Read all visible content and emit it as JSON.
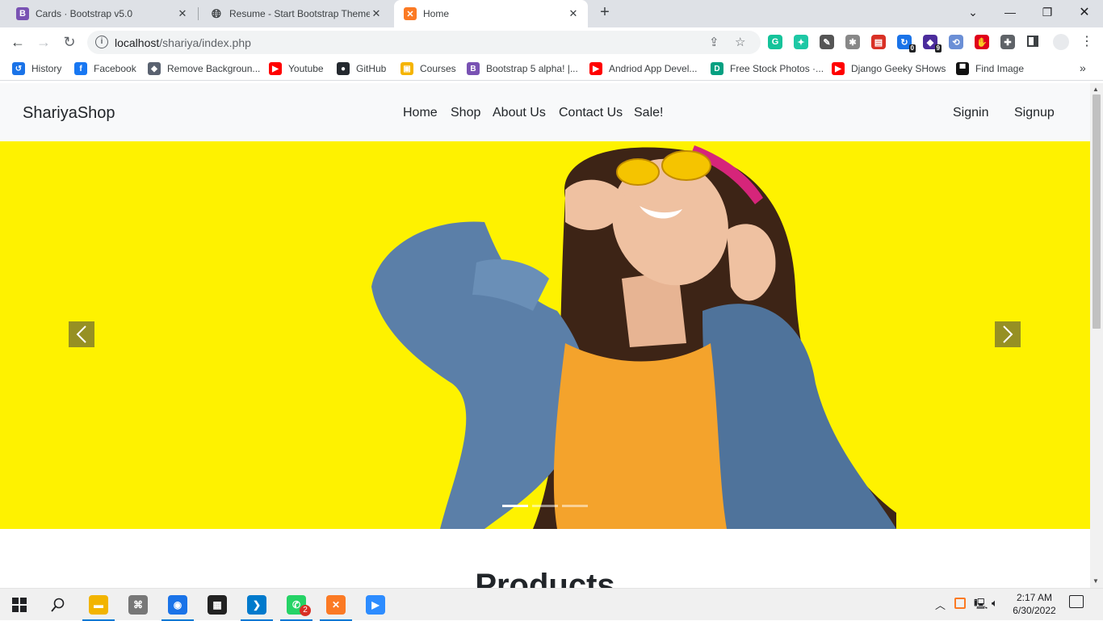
{
  "browser": {
    "tabs": [
      {
        "title": "Cards · Bootstrap v5.0",
        "icon": "bootstrap-icon",
        "color": "#7952b3"
      },
      {
        "title": "Resume - Start Bootstrap Theme",
        "icon": "globe-icon",
        "color": "#5f6368"
      },
      {
        "title": "Home",
        "icon": "xampp-icon",
        "color": "#fb7a24"
      }
    ],
    "new_tab": "+",
    "url_host": "localhost",
    "url_path": "/shariya/index.php",
    "bookmarks": [
      {
        "label": "History",
        "icon": "history-icon",
        "color": "#1a73e8"
      },
      {
        "label": "Facebook",
        "icon": "facebook-icon",
        "color": "#1877f2"
      },
      {
        "label": "Remove Backgroun...",
        "icon": "removebg-icon",
        "color": "#5a6270"
      },
      {
        "label": "Youtube",
        "icon": "youtube-icon",
        "color": "#ff0000"
      },
      {
        "label": "GitHub",
        "icon": "github-icon",
        "color": "#24292f"
      },
      {
        "label": "Courses",
        "icon": "classroom-icon",
        "color": "#f5b400"
      },
      {
        "label": "Bootstrap 5 alpha! |...",
        "icon": "bootstrap-icon",
        "color": "#7952b3"
      },
      {
        "label": "Andriod App Devel...",
        "icon": "youtube-icon",
        "color": "#ff0000"
      },
      {
        "label": "Free Stock Photos ·...",
        "icon": "stock-photo-icon",
        "color": "#05a081"
      },
      {
        "label": "Django Geeky SHows",
        "icon": "youtube-icon",
        "color": "#ff0000"
      },
      {
        "label": "Find Image",
        "icon": "unsplash-icon",
        "color": "#111111"
      }
    ],
    "extensions": [
      {
        "icon": "grammarly-icon",
        "color": "#15c39a",
        "badge": ""
      },
      {
        "icon": "tweeter-icon",
        "color": "#1ec8a5",
        "badge": ""
      },
      {
        "icon": "eyedropper-icon",
        "color": "#555555",
        "badge": ""
      },
      {
        "icon": "bug-icon",
        "color": "#888888",
        "badge": ""
      },
      {
        "icon": "web-page-icon",
        "color": "#d93025",
        "badge": ""
      },
      {
        "icon": "refresh-ext-icon",
        "color": "#1a73e8",
        "badge": "0"
      },
      {
        "icon": "gem-icon",
        "color": "#4b2c9c",
        "badge": "9"
      },
      {
        "icon": "loop-icon",
        "color": "#6b8fd6",
        "badge": ""
      },
      {
        "icon": "adblock-icon",
        "color": "#e0001b",
        "badge": ""
      },
      {
        "icon": "puzzle-icon",
        "color": "#5f6368",
        "badge": ""
      }
    ]
  },
  "site": {
    "brand": "ShariyaShop",
    "nav": [
      "Home",
      "Shop",
      "About Us",
      "Contact Us",
      "Sale!"
    ],
    "auth": [
      "Signin",
      "Signup"
    ],
    "carousel_slides": 3,
    "carousel_active": 1,
    "section_heading": "Products"
  },
  "taskbar": {
    "apps": [
      {
        "icon": "file-explorer-icon",
        "color": "#f2b400",
        "open": true
      },
      {
        "icon": "network-tool-icon",
        "color": "#777777",
        "open": false
      },
      {
        "icon": "chrome-icon",
        "color": "#1a73e8",
        "open": true
      },
      {
        "icon": "chip-app-icon",
        "color": "#222222",
        "open": false
      },
      {
        "icon": "vscode-icon",
        "color": "#007acc",
        "open": true
      },
      {
        "icon": "whatsapp-icon",
        "color": "#25d366",
        "open": true,
        "badge": "2"
      },
      {
        "icon": "xampp-icon",
        "color": "#fb7a24",
        "open": true
      },
      {
        "icon": "zoom-icon",
        "color": "#2d8cff",
        "open": false
      }
    ],
    "time": "2:17 AM",
    "date": "6/30/2022"
  }
}
